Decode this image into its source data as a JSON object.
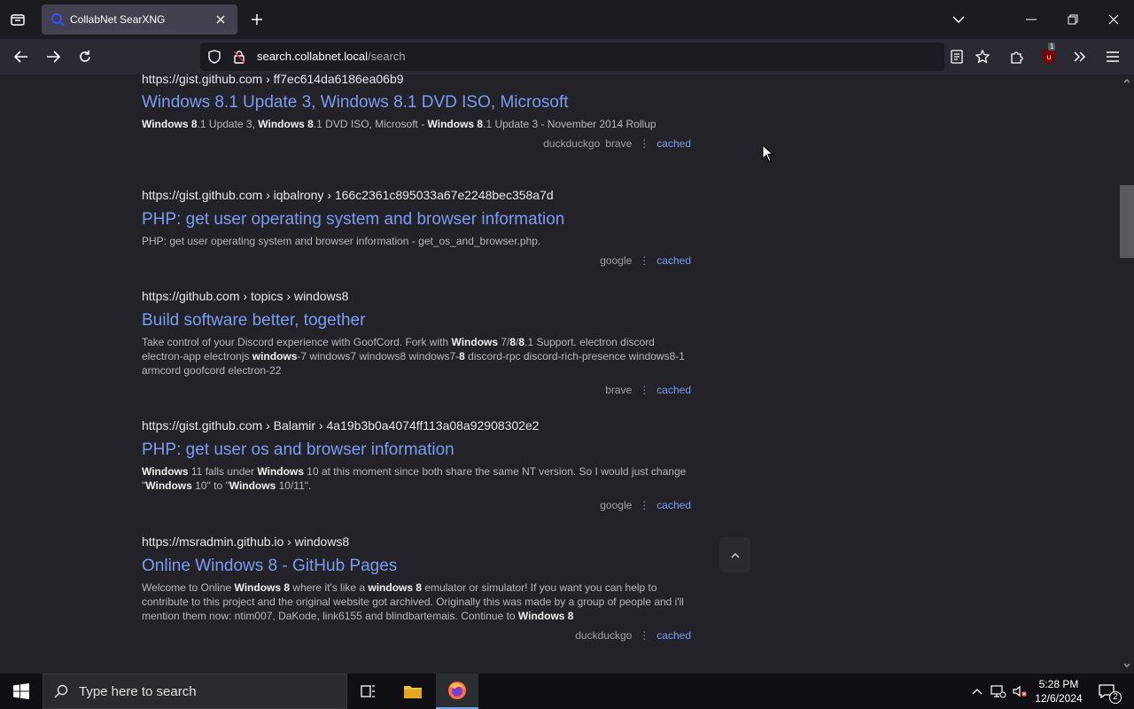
{
  "browser": {
    "tab_title": "CollabNet SearXNG",
    "url_domain": "search.collabnet.local",
    "url_path": "/search",
    "extension_badge": "1"
  },
  "results": [
    {
      "url": "https://gist.github.com  › ff7ec614da6186ea06b9",
      "title": "Windows 8.1 Update 3, Windows 8.1 DVD ISO, Microsoft",
      "snippet_html": "<b>Windows 8</b>.1 Update 3, <b>Windows 8</b>.1 DVD ISO, Microsoft - <b>Windows 8</b>.1 Update 3 - November 2014 Rollup",
      "engines": [
        "duckduckgo",
        "brave"
      ],
      "cached": "cached"
    },
    {
      "url": "https://gist.github.com  › iqbalrony › 166c2361c895033a67e2248bec358a7d",
      "title": "PHP: get user operating system and browser information",
      "snippet_html": "PHP: get user operating system and browser information - get_os_and_browser.php.",
      "engines": [
        "google"
      ],
      "cached": "cached"
    },
    {
      "url": "https://github.com  › topics › windows8",
      "title": "Build software better, together",
      "snippet_html": "Take control of your Discord experience with GoofCord. Fork with <b>Windows</b> 7/<b>8</b>/<b>8</b>.1 Support. electron discord electron-app electronjs <b>windows</b>-7 windows7 windows8 windows7-<b>8</b> discord-rpc discord-rich-presence windows8-1 armcord goofcord electron-22",
      "engines": [
        "brave"
      ],
      "cached": "cached"
    },
    {
      "url": "https://gist.github.com  › Balamir › 4a19b3b0a4074ff113a08a92908302e2",
      "title": "PHP: get user os and browser information",
      "snippet_html": "<b>Windows</b> 11 falls under <b>Windows</b> 10 at this moment since both share the same NT version. So I would just change \"<b>Windows</b> 10\" to \"<b>Windows</b> 10/11\".",
      "engines": [
        "google"
      ],
      "cached": "cached"
    },
    {
      "url": "https://msradmin.github.io  › windows8",
      "title": "Online Windows 8 - GitHub Pages",
      "snippet_html": "Welcome to Online <b>Windows 8</b> where it's like a <b>windows 8</b> emulator or simulator! If you want you can help to contribute to this project and the original website got archived. Originally this was made by a group of people and i'll mention them now: ntim007, DaKode, link6155 and blindbartemais. Continue to <b>Windows 8</b>",
      "engines": [
        "duckduckgo"
      ],
      "cached": "cached"
    }
  ],
  "taskbar": {
    "search_placeholder": "Type here to search",
    "time": "5:28 PM",
    "date": "12/6/2024",
    "notification_count": "2"
  }
}
